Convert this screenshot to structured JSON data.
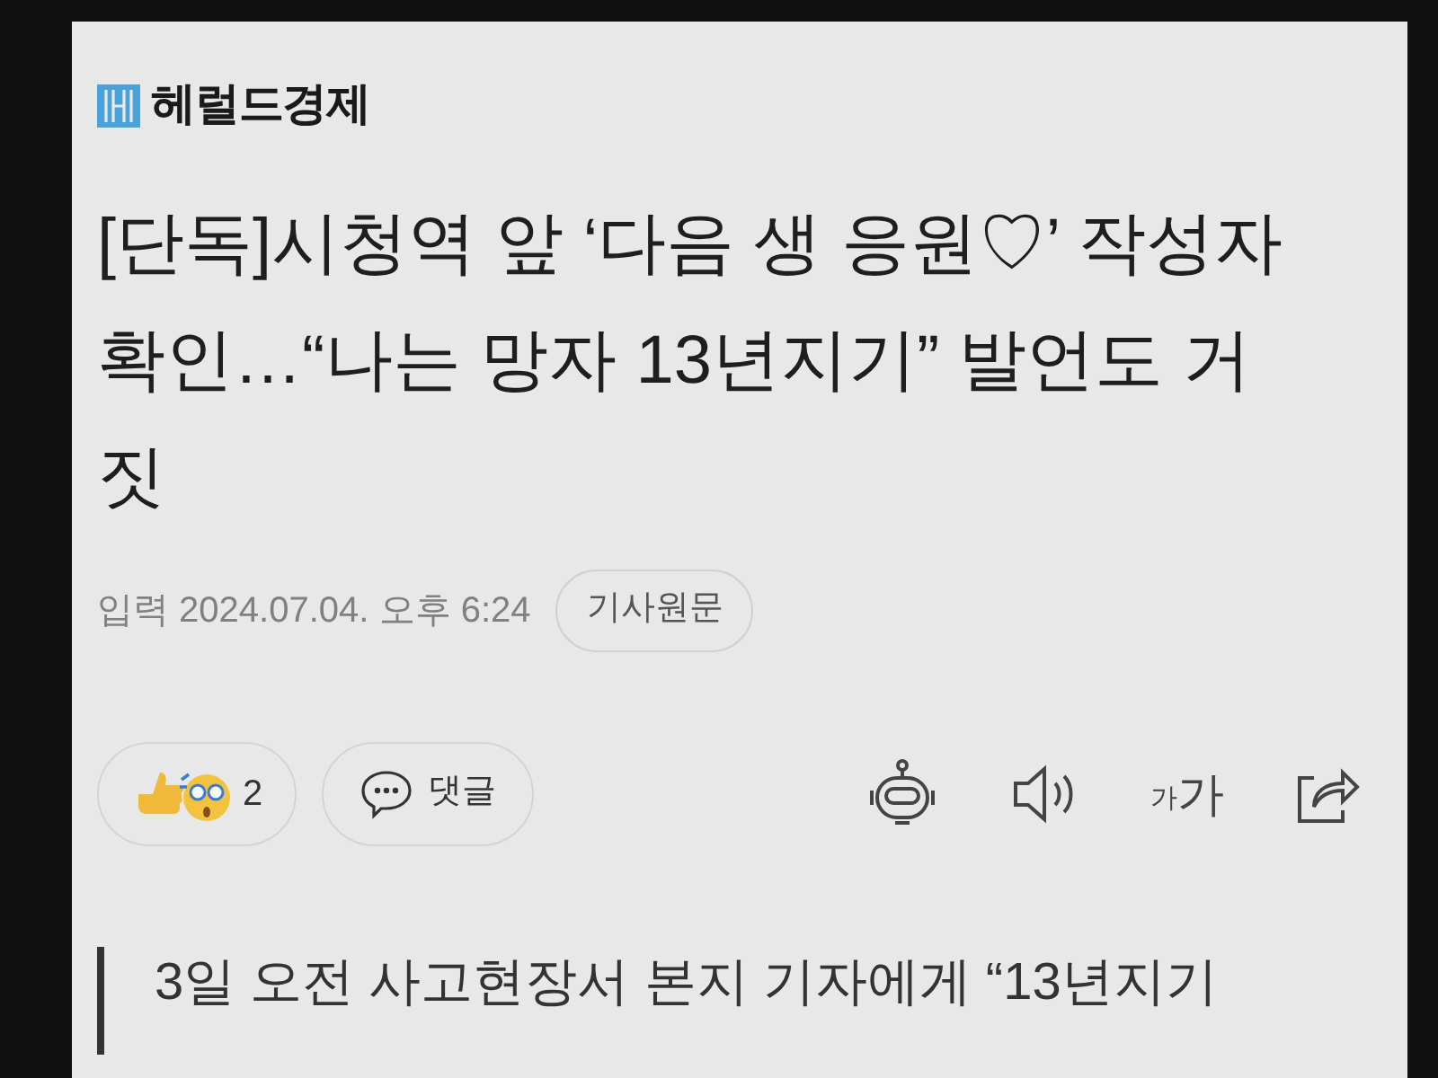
{
  "header": {
    "logo_text": "헤럴드경제"
  },
  "headline": "[단독]시청역 앞 ‘다음 생 응원♡’ 작성자 확인…“나는 망자 13년지기” 발언도 거짓",
  "meta": {
    "date": "입력 2024.07.04. 오후 6:24",
    "original_button": "기사원문"
  },
  "actions": {
    "reaction_count": "2",
    "comment_label": "댓글",
    "font_small": "가",
    "font_large": "가"
  },
  "subtitle": "3일 오전 사고현장서 본지 기자에게 “13년지기"
}
